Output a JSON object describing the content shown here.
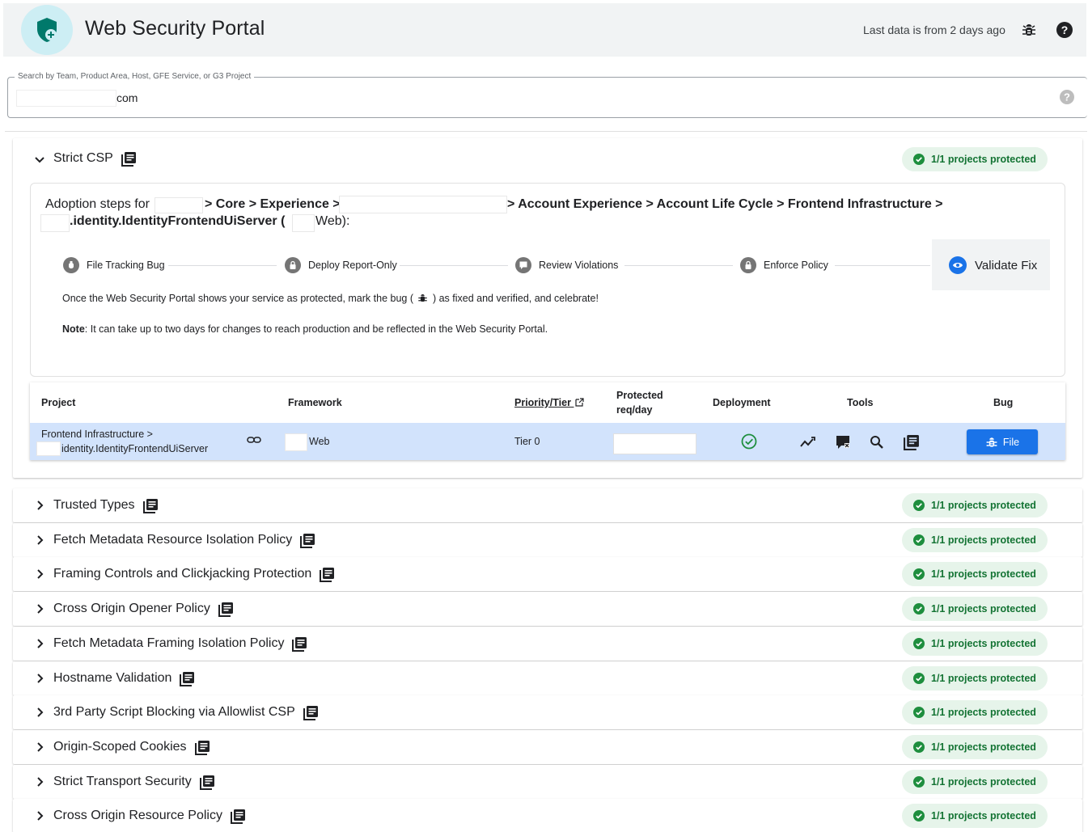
{
  "header": {
    "title": "Web Security Portal",
    "last_data": "Last data is from 2 days ago",
    "logo_icon": "shield-plus-icon",
    "bug_icon": "bug-icon",
    "help_icon": "help-icon"
  },
  "search": {
    "label": "Search by Team, Product Area, Host, GFE Service, or G3 Project",
    "value": "com"
  },
  "expanded": {
    "title": "Strict CSP",
    "status": "1/1 projects protected",
    "adoption": {
      "prefix": "Adoption steps for",
      "part1": "> Core > Experience >",
      "part2": "> Account Experience > Account Life Cycle > Frontend Infrastructure >",
      "part3": ".identity.IdentityFrontendUiServer (",
      "part4": "Web):"
    },
    "steps": [
      {
        "label": "File Tracking Bug",
        "icon": "bug-icon"
      },
      {
        "label": "Deploy Report-Only",
        "icon": "lock-icon"
      },
      {
        "label": "Review Violations",
        "icon": "review-icon"
      },
      {
        "label": "Enforce Policy",
        "icon": "lock-icon"
      },
      {
        "label": "Validate Fix",
        "icon": "eye-icon"
      }
    ],
    "info_pre": "Once the Web Security Portal shows your service as protected, mark the bug (",
    "info_post": ") as fixed and verified, and celebrate!",
    "note_label": "Note",
    "note_text": ": It can take up to two days for changes to reach production and be reflected in the Web Security Portal.",
    "table": {
      "headers": {
        "project": "Project",
        "framework": "Framework",
        "priority": "Priority/Tier",
        "protected_line1": "Protected",
        "protected_line2": "req/day",
        "deployment": "Deployment",
        "tools": "Tools",
        "bug": "Bug"
      },
      "row": {
        "project_line1": "Frontend Infrastructure >",
        "project_line2": "identity.IdentityFrontendUiServer",
        "framework": "Web",
        "tier": "Tier 0",
        "protected": "",
        "bug_button": "File"
      }
    }
  },
  "collapsed": [
    {
      "title": "Trusted Types",
      "status": "1/1 projects protected"
    },
    {
      "title": "Fetch Metadata Resource Isolation Policy",
      "status": "1/1 projects protected"
    },
    {
      "title": "Framing Controls and Clickjacking Protection",
      "status": "1/1 projects protected"
    },
    {
      "title": "Cross Origin Opener Policy",
      "status": "1/1 projects protected"
    },
    {
      "title": "Fetch Metadata Framing Isolation Policy",
      "status": "1/1 projects protected"
    },
    {
      "title": "Hostname Validation",
      "status": "1/1 projects protected"
    },
    {
      "title": "3rd Party Script Blocking via Allowlist CSP",
      "status": "1/1 projects protected"
    },
    {
      "title": "Origin-Scoped Cookies",
      "status": "1/1 projects protected"
    },
    {
      "title": "Strict Transport Security",
      "status": "1/1 projects protected"
    },
    {
      "title": "Cross Origin Resource Policy",
      "status": "1/1 projects protected"
    }
  ],
  "colors": {
    "accent": "#1a73e8",
    "success": "#137333",
    "success_bg": "#e6f4ea",
    "row_highlight": "#d2e3fc"
  }
}
